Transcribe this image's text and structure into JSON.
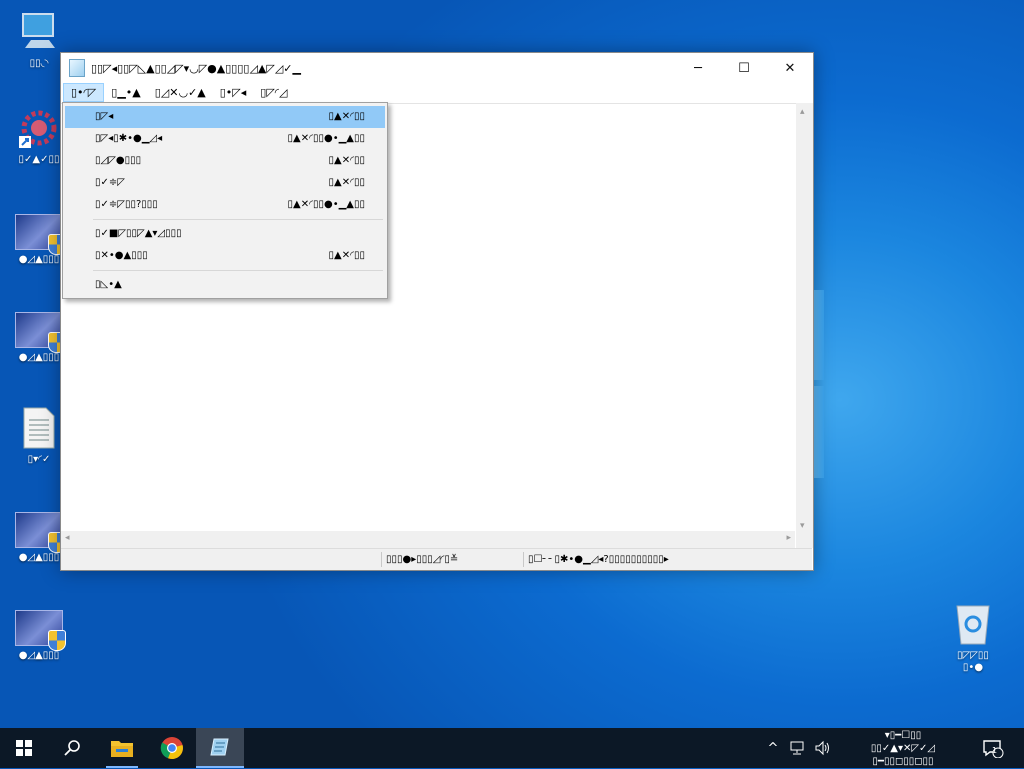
{
  "desktop": {
    "icons": [
      {
        "label": "▯▯◟◝",
        "icon": "computer-icon"
      },
      {
        "label": "▯✓▲✓▯▯",
        "icon": "gear-shortcut-icon"
      },
      {
        "label": "●◿▲▯▯▯",
        "icon": "shield-app-icon"
      },
      {
        "label": "●◿▲▯▯▯",
        "icon": "shield-app-icon"
      },
      {
        "label": "▯▾◜✓",
        "icon": "text-file-icon"
      },
      {
        "label": "●◿▲▯▯▯",
        "icon": "shield-app-icon"
      },
      {
        "label": "●◿▲▯▯▯",
        "icon": "shield-app-icon"
      }
    ],
    "recycle_bin": {
      "line1": "▯◸◸▯▯",
      "line2": "▯•●",
      "icon": "recycle-bin-icon"
    }
  },
  "window": {
    "title": "▯▯◸◂▯▯◸◺▲▯▯◿◸▾◡◸●▲▯▯▯▯◿▲◸◿✓▁",
    "minimize": "─",
    "maximize": "☐",
    "close": "✕",
    "menu": [
      "▯•◜◸",
      "▯▁•▲",
      "▯◿✕◡✓▲",
      "▯•◸◂",
      "▯◸◜◿"
    ]
  },
  "dropdown": {
    "items": [
      {
        "label": "▯◸◂",
        "shortcut": "▯▲✕◜▯▯"
      },
      {
        "label": "▯◸◂▯✱•●▁◿◂",
        "shortcut": "▯▲✕◜▯▯●•▁▲▯▯"
      },
      {
        "label": "▯◿◸●▯▯▯",
        "shortcut": "▯▲✕◜▯▯"
      },
      {
        "label": "▯✓≑◸",
        "shortcut": "▯▲✕◜▯▯"
      },
      {
        "label": "▯✓≑◸▯▯?▯▯▯",
        "shortcut": "▯▲✕◜▯▯●•▁▲▯▯"
      },
      {
        "label": "▯✓■◸▯▯◸▲▾◿▯▯▯",
        "shortcut": ""
      },
      {
        "label": "▯✕•●▲▯▯▯",
        "shortcut": "▯▲✕◜▯▯"
      },
      {
        "label": "▯◺•▲",
        "shortcut": ""
      }
    ]
  },
  "status": {
    "position": "▯▯▯●▸▯▯▯◿◜▯≚",
    "encoding": "▯☐╴╴▯✱•●▁◿◂?▯▯▯▯▯▯▯▯▯▯▸"
  },
  "taskbar": {
    "start": "⊞",
    "search": "⚲",
    "tray_chevron": "^",
    "network": "▭",
    "volume": "🔊",
    "clock_line1": "▾▯━☐▯▯",
    "clock_line2": "▯▯✓▲▾✕◸✓◿",
    "clock_line3": "▯━▯▯◻▯▯◻▯▯",
    "notification_count": "1"
  },
  "colors": {
    "menu_highlight": "#91c9f7",
    "taskbar": "#0c1826",
    "desktop_blue": "#0c6bd0"
  }
}
